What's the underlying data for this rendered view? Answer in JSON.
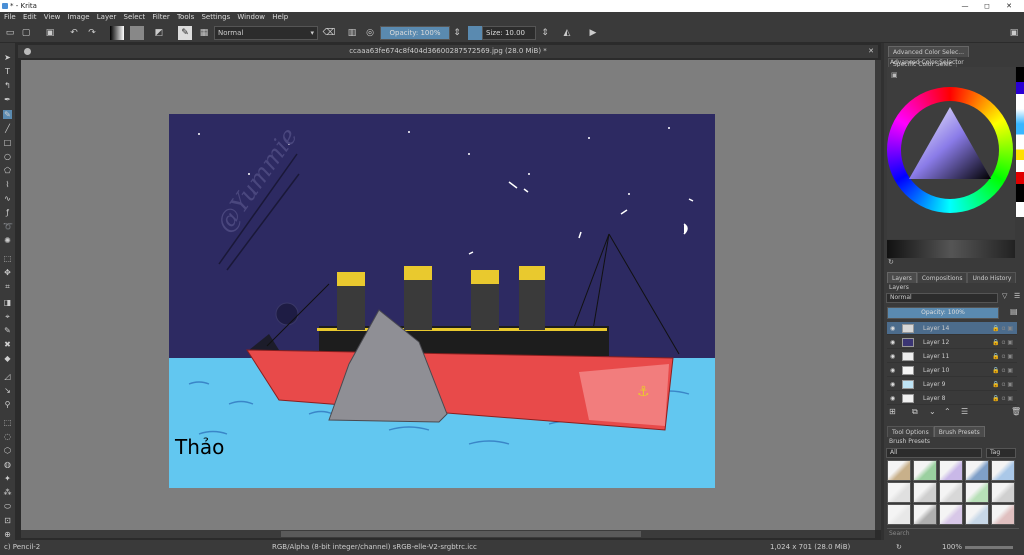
{
  "window": {
    "title": "* - Krita",
    "min": "—",
    "max": "◻",
    "close": "✕"
  },
  "menu": [
    "File",
    "Edit",
    "View",
    "Image",
    "Layer",
    "Select",
    "Filter",
    "Tools",
    "Settings",
    "Window",
    "Help"
  ],
  "toolbar": {
    "blend_mode": "Normal",
    "opacity_label": "Opacity: 100%",
    "opacity_value": 100,
    "size_label": "Size: 10.00 px"
  },
  "document": {
    "tab_title": "ccaaa63fe674c8f404d36600287572569.jpg (28.0 MiB) *"
  },
  "artwork": {
    "signature": "@Yummie",
    "name": "Thảo"
  },
  "right_panel": {
    "color_tabs": [
      "Advanced Color Selec...",
      "Specific Color Selec"
    ],
    "color_title": "Advanced Color Selector",
    "layer_tabs": [
      "Layers",
      "Compositions",
      "Undo History"
    ],
    "layers_title": "Layers",
    "layer_blend": "Normal",
    "layer_opacity": "Opacity: 100%",
    "layers": [
      {
        "name": "Layer 14",
        "selected": true,
        "thumb": "#d8d8d8"
      },
      {
        "name": "Layer 12",
        "selected": false,
        "thumb": "#3b3574"
      },
      {
        "name": "Layer 11",
        "selected": false,
        "thumb": "#eeeeee"
      },
      {
        "name": "Layer 10",
        "selected": false,
        "thumb": "#f5f5f5"
      },
      {
        "name": "Layer 9",
        "selected": false,
        "thumb": "#bfe4f5"
      },
      {
        "name": "Layer 8",
        "selected": false,
        "thumb": "#f0f0f0"
      }
    ],
    "tool_tabs": [
      "Tool Options",
      "Brush Presets"
    ],
    "brush_title": "Brush Presets",
    "brush_filter": "All",
    "tag_label": "Tag",
    "search_placeholder": "Search"
  },
  "status": {
    "tool": "c) Pencil-2",
    "color_info": "RGB/Alpha (8-bit integer/channel)  sRGB-elle-V2-srgbtrc.icc",
    "dims": "1,024 x 701 (28.0 MiB)",
    "zoom": "100%"
  },
  "colors": {
    "sky": "#2d2a62",
    "water": "#62c7f0",
    "hull": "#e84a4a",
    "funnel": "#e9c92e"
  }
}
